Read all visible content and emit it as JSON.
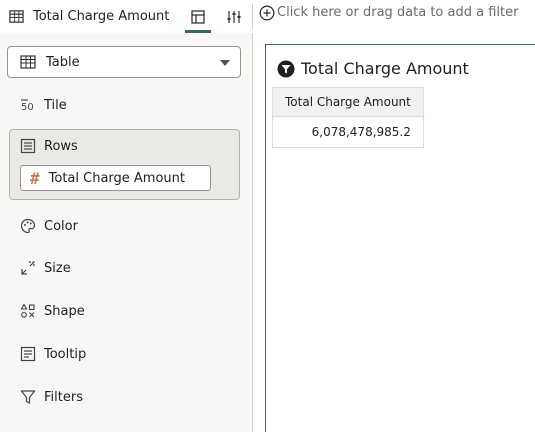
{
  "topbar": {
    "title": "Total Charge Amount",
    "title_icon": "table-icon",
    "tabs": [
      {
        "name": "grammar-panel-tab",
        "icon": "panel-layout-icon",
        "active": true
      },
      {
        "name": "properties-tab",
        "icon": "sliders-icon",
        "active": false
      }
    ],
    "filter_placeholder": "Click here or drag data to add a filter",
    "accent_color": "#3a6b55"
  },
  "sidebar": {
    "viz_type": {
      "label": "Table",
      "icon": "table-icon"
    },
    "items": [
      {
        "label": "Tile",
        "icon": "tile-number-icon"
      },
      {
        "label": "Rows",
        "icon": "rows-icon"
      },
      {
        "label": "Color",
        "icon": "palette-icon"
      },
      {
        "label": "Size",
        "icon": "size-icon"
      },
      {
        "label": "Shape",
        "icon": "shape-icon"
      },
      {
        "label": "Tooltip",
        "icon": "tooltip-icon"
      },
      {
        "label": "Filters",
        "icon": "filter-icon"
      }
    ],
    "rows_pill": {
      "label": "Total Charge Amount",
      "symbol": "#"
    }
  },
  "canvas": {
    "title": "Total Charge Amount",
    "title_icon": "funnel-badge-icon",
    "table": {
      "columns": [
        "Total Charge Amount"
      ],
      "rows": [
        [
          "6,078,478,985.2"
        ]
      ]
    }
  }
}
